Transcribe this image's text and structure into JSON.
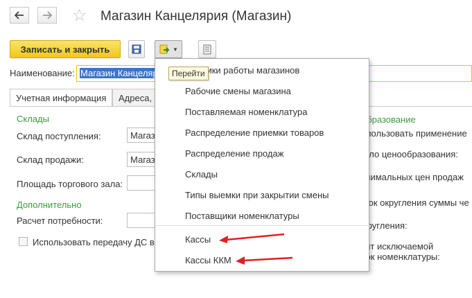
{
  "header": {
    "title": "Магазин Канцелярия (Магазин)",
    "back_icon": "arrow-left-icon",
    "forward_icon": "arrow-right-icon",
    "favorite_icon": "star-icon"
  },
  "toolbar": {
    "save_close_label": "Записать и закрыть",
    "save_icon": "floppy-disk-icon",
    "goto_icon": "goto-document-icon",
    "list_icon": "list-report-icon"
  },
  "tooltip": "Перейти",
  "name_label": "Наименование:",
  "name_value": "Магазин Канцелярия",
  "tabs": [
    "Учетная информация",
    "Адреса,"
  ],
  "sections": {
    "warehouses": "Склады",
    "additional": "Дополнительно"
  },
  "fields": {
    "receipt_label": "Склад поступления:",
    "receipt_value": "Магаз",
    "sales_label": "Склад продажи:",
    "sales_value": "Магаз",
    "area_label": "Площадь торгового зала:",
    "calc_label": "Расчет потребности:",
    "transfer_checkbox_label": "Использовать передачу ДС в"
  },
  "right_fragments": {
    "pricing_section": "образование",
    "use_apply": "спользовать применение",
    "pricing_rule": "ило ценообразования:",
    "min_prices": "инимальных цен продаж",
    "rounding_order": "док округления суммы че",
    "rounding": "кругления:",
    "exclude_line1": "ент исключаемой",
    "exclude_line2": "док номенклатуры:"
  },
  "menu": {
    "items": [
      "Графики работы магазинов",
      "Рабочие смены магазина",
      "Поставляемая номенклатура",
      "Распределение приемки товаров",
      "Распределение продаж",
      "Склады",
      "Типы выемки при закрытии смены",
      "Поставщики номенклатуры",
      "Кассы",
      "Кассы ККМ"
    ]
  },
  "colors": {
    "accent_yellow": "#f1c71a",
    "section_green": "#3d9a3d",
    "selection_blue": "#3d74c8",
    "annotation_red": "#e02020"
  }
}
